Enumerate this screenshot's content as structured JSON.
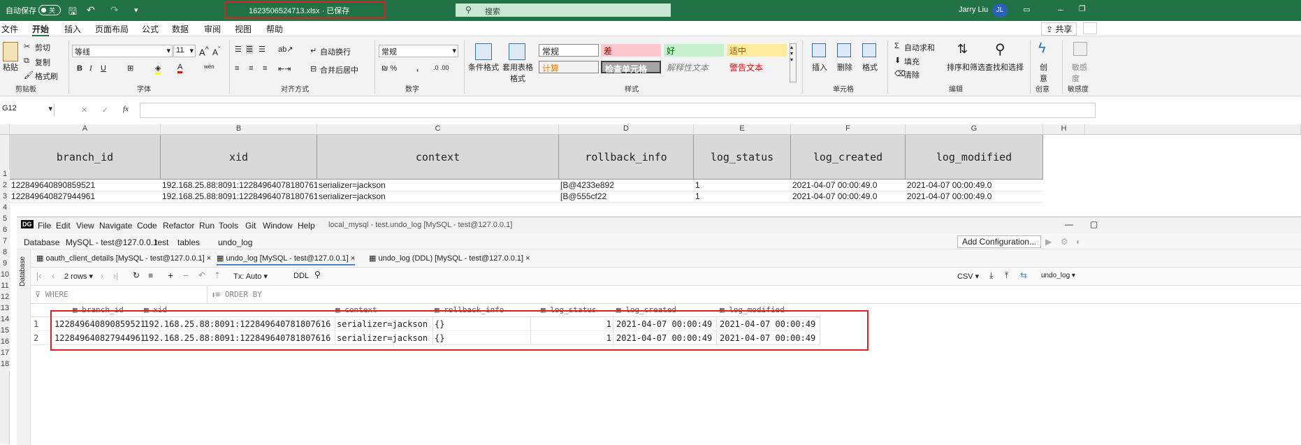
{
  "titlebar": {
    "autosave": "自动保存",
    "toggle": "关",
    "filename": "1623506524713.xlsx · 已保存",
    "search": "搜索",
    "user": "Jarry Liu",
    "avatar": "JL"
  },
  "menu": [
    "文件",
    "开始",
    "插入",
    "页面布局",
    "公式",
    "数据",
    "审阅",
    "视图",
    "帮助"
  ],
  "share": "共享",
  "ribbon": {
    "clipboard": {
      "paste": "粘贴",
      "cut": "剪切",
      "copy": "复制",
      "format_painter": "格式刷",
      "group": "剪贴板"
    },
    "font": {
      "name": "等线",
      "size": "11",
      "group": "字体"
    },
    "align": {
      "wrap": "自动换行",
      "merge": "合并后居中",
      "group": "对齐方式"
    },
    "number": {
      "format": "常规",
      "group": "数字"
    },
    "styles": {
      "conditional": "条件格式",
      "table": "套用表格格式",
      "group": "样式",
      "items": [
        {
          "label": "常规",
          "color": "#000000",
          "bg": "#ffffff"
        },
        {
          "label": "差",
          "color": "#9c0006",
          "bg": "#ffc7ce"
        },
        {
          "label": "好",
          "color": "#006100",
          "bg": "#c6efce"
        },
        {
          "label": "适中",
          "color": "#9c5700",
          "bg": "#ffeb9c"
        },
        {
          "label": "计算",
          "color": "#fa7d00",
          "bg": "#f2f2f2"
        },
        {
          "label": "检查单元格",
          "color": "#ffffff",
          "bg": "#a5a5a5"
        },
        {
          "label": "解释性文本",
          "color": "#7f7f7f",
          "bg": "#f3f3f3"
        },
        {
          "label": "警告文本",
          "color": "#ff0000",
          "bg": "#f3f3f3"
        }
      ]
    },
    "cells": {
      "insert": "插入",
      "delete": "删除",
      "format": "格式",
      "group": "单元格"
    },
    "editing": {
      "autosum": "自动求和",
      "fill": "填充",
      "clear": "清除",
      "sort": "排序和筛选",
      "find": "查找和选择",
      "group": "编辑"
    },
    "creative": {
      "label": "创意",
      "group": "创意"
    },
    "sensitivity": {
      "label": "敏感度",
      "group": "敏感度"
    }
  },
  "formula": {
    "cell_ref": "G12",
    "fx": "fx"
  },
  "sheet": {
    "columns": [
      "A",
      "B",
      "C",
      "D",
      "E",
      "F",
      "G",
      "H"
    ],
    "rows": [
      "1",
      "2",
      "3",
      "4",
      "5",
      "6",
      "7",
      "8",
      "9",
      "10",
      "11",
      "12",
      "13",
      "14",
      "15",
      "16",
      "17",
      "18"
    ],
    "headers": [
      "branch_id",
      "xid",
      "context",
      "rollback_info",
      "log_status",
      "log_created",
      "log_modified"
    ],
    "data": [
      [
        "122849640890859521",
        "192.168.25.88:8091:122849640781807616",
        "serializer=jackson",
        "[B@4233e892",
        "1",
        "2021-04-07 00:00:49.0",
        "2021-04-07 00:00:49.0"
      ],
      [
        "122849640827944961",
        "192.168.25.88:8091:122849640781807616",
        "serializer=jackson",
        "[B@555cf22",
        "1",
        "2021-04-07 00:00:49.0",
        "2021-04-07 00:00:49.0"
      ]
    ]
  },
  "datagrip": {
    "logo": "DG",
    "menu": [
      "File",
      "Edit",
      "View",
      "Navigate",
      "Code",
      "Refactor",
      "Run",
      "Tools",
      "Git",
      "Window",
      "Help"
    ],
    "window_title": "local_mysql - test.undo_log [MySQL - test@127.0.0.1]",
    "breadcrumb": [
      "Database",
      "MySQL - test@127.0.0.1",
      "test",
      "tables",
      "undo_log"
    ],
    "add_config": "Add Configuration...",
    "side_label": "Database",
    "tabs": [
      "oauth_client_details [MySQL - test@127.0.0.1]",
      "undo_log [MySQL - test@127.0.0.1]",
      "undo_log (DDL) [MySQL - test@127.0.0.1]"
    ],
    "toolbar": {
      "rows": "2 rows",
      "tx": "Tx: Auto",
      "ddl": "DDL",
      "csv": "CSV",
      "table": "undo_log"
    },
    "where": "WHERE",
    "order_by": "ORDER BY",
    "columns": [
      "branch_id",
      "xid",
      "context",
      "rollback_info",
      "log_status",
      "log_created",
      "log_modified"
    ],
    "rows": [
      {
        "num": "1",
        "cells": [
          "122849640890859521",
          "192.168.25.88:8091:122849640781807616",
          "serializer=jackson",
          "{}",
          "1",
          "2021-04-07 00:00:49",
          "2021-04-07 00:00:49"
        ]
      },
      {
        "num": "2",
        "cells": [
          "122849640827944961",
          "192.168.25.88:8091:122849640781807616",
          "serializer=jackson",
          "{}",
          "1",
          "2021-04-07 00:00:49",
          "2021-04-07 00:00:49"
        ]
      }
    ]
  }
}
